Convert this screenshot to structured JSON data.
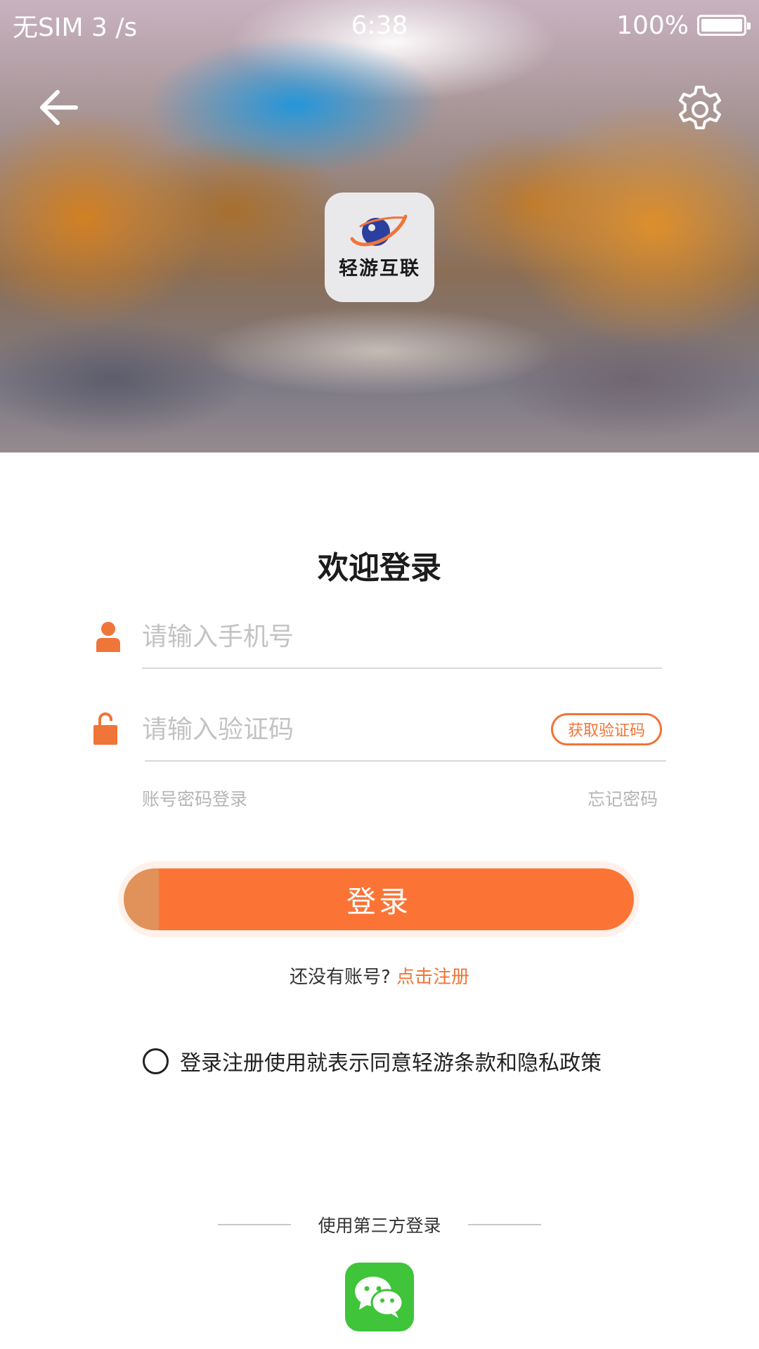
{
  "status_bar": {
    "carrier": "无SIM 3",
    "network_speed": "/s",
    "time": "6:38",
    "battery": "100%"
  },
  "header": {
    "back_icon": "arrow-left-icon",
    "settings_icon": "gear-icon",
    "logo_text": "轻游互联"
  },
  "form": {
    "title": "欢迎登录",
    "phone_placeholder": "请输入手机号",
    "code_placeholder": "请输入验证码",
    "get_code_label": "获取验证码",
    "account_password_login": "账号密码登录",
    "forgot_password": "忘记密码",
    "login_label": "登录",
    "no_account_text": "还没有账号?",
    "register_link": "点击注册",
    "agreement_text": "登录注册使用就表示同意轻游条款和隐私政策"
  },
  "third_party": {
    "title": "使用第三方登录",
    "wechat_icon": "wechat-icon"
  },
  "colors": {
    "accent": "#F07538",
    "login_button": "#FB7436",
    "wechat": "#3FC43A"
  }
}
